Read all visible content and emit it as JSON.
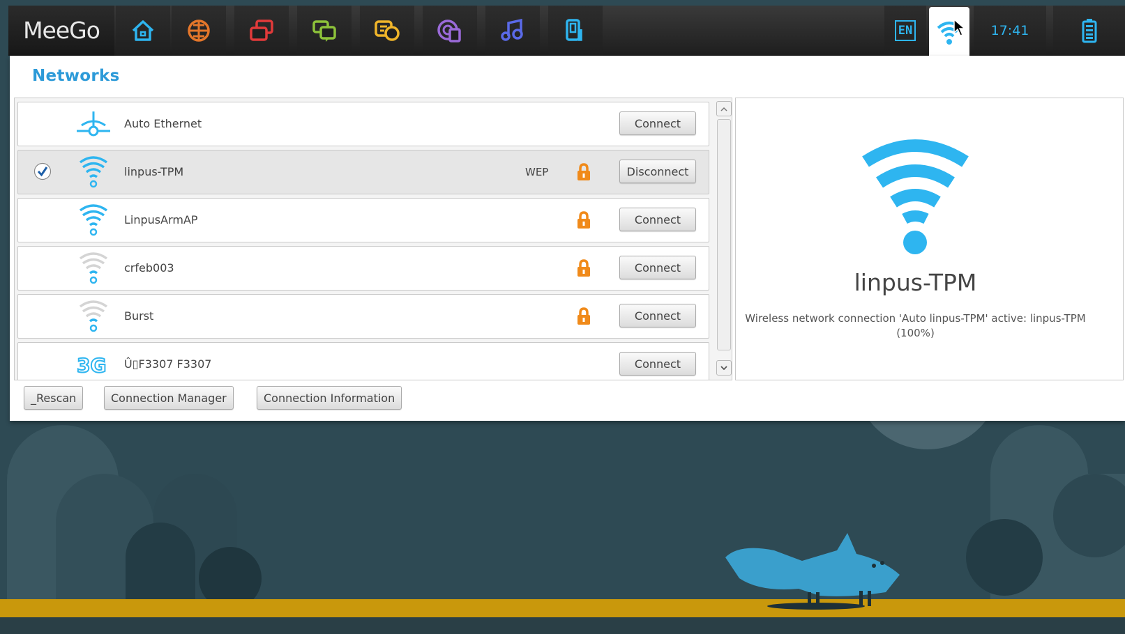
{
  "topbar": {
    "logo": "MeeGo",
    "zones": [
      {
        "icon": "home-icon",
        "color": "#2eb5f0"
      },
      {
        "icon": "applications-icon",
        "color": "#e4762a"
      },
      {
        "icon": "zones-icon",
        "color": "#e23a3a"
      },
      {
        "icon": "people-icon",
        "color": "#8dc23a"
      },
      {
        "icon": "status-icon",
        "color": "#f0b52a"
      },
      {
        "icon": "internet-icon",
        "color": "#9a6ad8"
      },
      {
        "icon": "music-icon",
        "color": "#5a6ae8"
      },
      {
        "icon": "devices-icon",
        "color": "#2eb5f0"
      }
    ],
    "language": "EN",
    "time": "17:41",
    "network_icon": "wifi-icon",
    "battery_icon": "battery-icon"
  },
  "panel": {
    "title": "Networks",
    "networks": [
      {
        "name": "Auto Ethernet",
        "icon": "ethernet-icon",
        "security": "",
        "locked": false,
        "connected": false,
        "button": "Connect"
      },
      {
        "name": "linpus-TPM",
        "icon": "wifi-strong-icon",
        "security": "WEP",
        "locked": true,
        "connected": true,
        "button": "Disconnect"
      },
      {
        "name": "LinpusArmAP",
        "icon": "wifi-strong-icon",
        "security": "",
        "locked": true,
        "connected": false,
        "button": "Connect"
      },
      {
        "name": "crfeb003",
        "icon": "wifi-weak-icon",
        "security": "",
        "locked": true,
        "connected": false,
        "button": "Connect"
      },
      {
        "name": "Burst",
        "icon": "wifi-weak-icon",
        "security": "",
        "locked": true,
        "connected": false,
        "button": "Connect"
      },
      {
        "name": "Û▯F3307 F3307",
        "icon": "3g-icon",
        "security": "",
        "locked": false,
        "connected": false,
        "button": "Connect"
      }
    ],
    "detail": {
      "name": "linpus-TPM",
      "description": "Wireless network connection 'Auto linpus-TPM' active: linpus-TPM (100%)"
    },
    "buttons": {
      "rescan": "_Rescan",
      "manager": "Connection Manager",
      "info": "Connection Information"
    }
  },
  "colors": {
    "accent": "#2eb5f0",
    "title": "#2c9ad8",
    "lock": "#f08a1a",
    "road": "#c9980c",
    "background": "#2c4851"
  }
}
